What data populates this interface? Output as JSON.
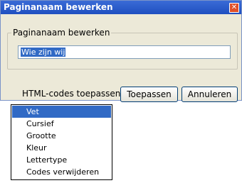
{
  "window": {
    "title": "Paginanaam bewerken",
    "close_glyph": "✕"
  },
  "group": {
    "legend": "Paginanaam bewerken",
    "input_value": "Wie zijn wij"
  },
  "footer": {
    "html_codes_label": "HTML-codes toepassen",
    "apply_label": "Toepassen",
    "cancel_label": "Annuleren"
  },
  "dropdown": {
    "items": [
      "Vet",
      "Cursief",
      "Grootte",
      "Kleur",
      "Lettertype",
      "Codes verwijderen"
    ],
    "selected_index": 0
  },
  "colors": {
    "title_bar": "#1f4fc0",
    "selection": "#316ac5",
    "dialog_bg": "#ece9d8"
  }
}
